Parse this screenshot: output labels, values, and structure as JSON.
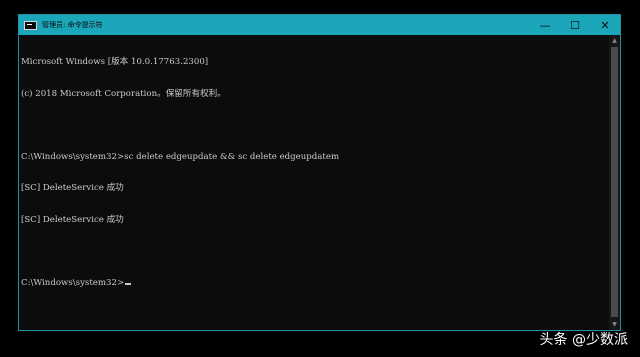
{
  "window": {
    "title": "管理员: 命令提示符",
    "controls": {
      "minimize": "—",
      "maximize": "☐",
      "close": "✕"
    }
  },
  "console": {
    "lines": [
      "Microsoft Windows [版本 10.0.17763.2300]",
      "(c) 2018 Microsoft Corporation。保留所有权利。",
      "",
      "C:\\Windows\\system32>sc delete edgeupdate && sc delete edgeupdatem",
      "[SC] DeleteService 成功",
      "[SC] DeleteService 成功",
      "",
      "C:\\Windows\\system32>"
    ]
  },
  "scrollbar": {
    "up_arrow": "▲",
    "down_arrow": "▼"
  },
  "watermark": {
    "text": "头条 @少数派"
  }
}
